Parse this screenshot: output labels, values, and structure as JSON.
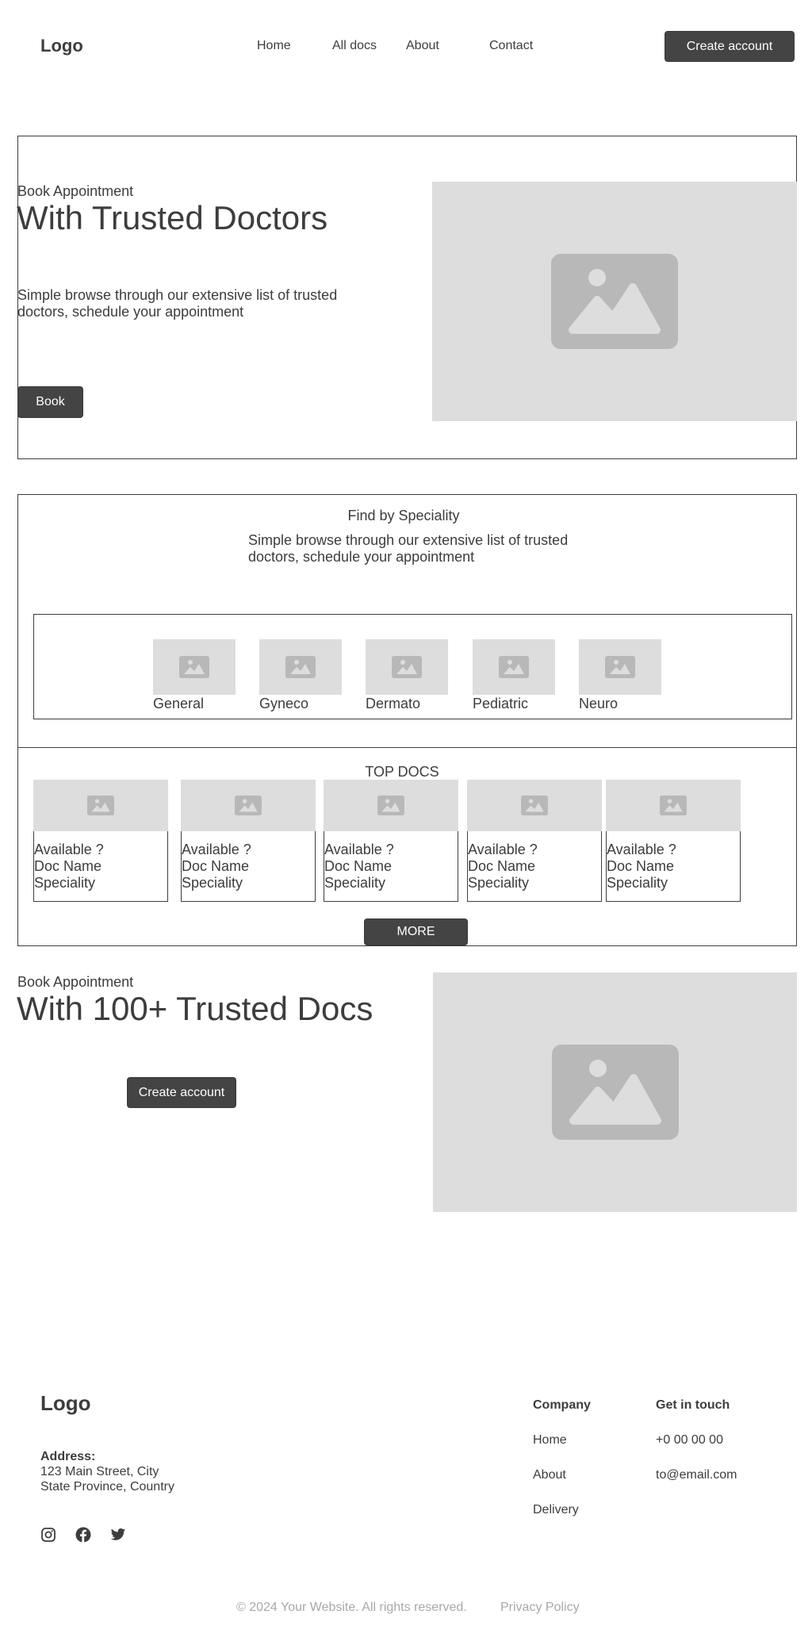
{
  "header": {
    "logo": "Logo",
    "nav": [
      {
        "label": "Home"
      },
      {
        "label": "All docs"
      },
      {
        "label": "About"
      },
      {
        "label": "Contact"
      }
    ],
    "cta": "Create account"
  },
  "hero": {
    "kicker": "Book Appointment",
    "title": "With Trusted Doctors",
    "description": "Simple browse through our extensive list of trusted doctors, schedule your appointment",
    "button": "Book",
    "image_icon": "image-placeholder-icon"
  },
  "speciality": {
    "title": "Find by Speciality",
    "description": "Simple browse through our extensive list of trusted doctors, schedule your appointment",
    "items": [
      {
        "label": "General"
      },
      {
        "label": "Gyneco"
      },
      {
        "label": "Dermato"
      },
      {
        "label": "Pediatric"
      },
      {
        "label": "Neuro"
      }
    ]
  },
  "top_docs": {
    "title": "TOP DOCS",
    "cards": [
      {
        "availability": "Available ?",
        "name": "Doc Name",
        "speciality": "Speciality"
      },
      {
        "availability": "Available ?",
        "name": "Doc Name",
        "speciality": "Speciality"
      },
      {
        "availability": "Available ?",
        "name": "Doc Name",
        "speciality": "Speciality"
      },
      {
        "availability": "Available ?",
        "name": "Doc Name",
        "speciality": "Speciality"
      },
      {
        "availability": "Available ?",
        "name": "Doc Name",
        "speciality": "Speciality"
      }
    ],
    "more_button": "MORE"
  },
  "promo": {
    "kicker": "Book Appointment",
    "title": "With 100+ Trusted Docs",
    "button": "Create account"
  },
  "footer": {
    "logo": "Logo",
    "address_label": "Address:",
    "address_line1": "123 Main Street, City",
    "address_line2": "State Province, Country",
    "social_icons": [
      "instagram-icon",
      "facebook-icon",
      "twitter-icon"
    ],
    "company": {
      "heading": "Company",
      "links": [
        {
          "label": "Home"
        },
        {
          "label": "About"
        },
        {
          "label": "Delivery"
        }
      ]
    },
    "contact": {
      "heading": "Get in touch",
      "phone": "+0 00 00 00",
      "email": "to@email.com"
    },
    "copyright": "© 2024 Your Website. All rights reserved.",
    "privacy": "Privacy Policy"
  },
  "colors": {
    "dark": "#444444",
    "text": "#3d3d3d",
    "placeholder_bg": "#dddddd",
    "placeholder_icon": "#b8b8b8",
    "muted": "#a8a8a8"
  }
}
